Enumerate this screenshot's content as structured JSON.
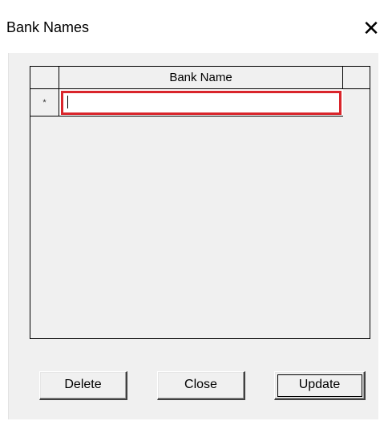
{
  "window": {
    "title": "Bank Names",
    "close_glyph": "✕"
  },
  "grid": {
    "columns": [
      "Bank Name"
    ],
    "new_row_marker": "*",
    "rows": [
      {
        "bank_name": ""
      }
    ]
  },
  "buttons": {
    "delete_label": "Delete",
    "close_label": "Close",
    "update_label": "Update"
  },
  "colors": {
    "active_cell_border": "#d9252b",
    "dialog_background": "#f0f0f0"
  }
}
